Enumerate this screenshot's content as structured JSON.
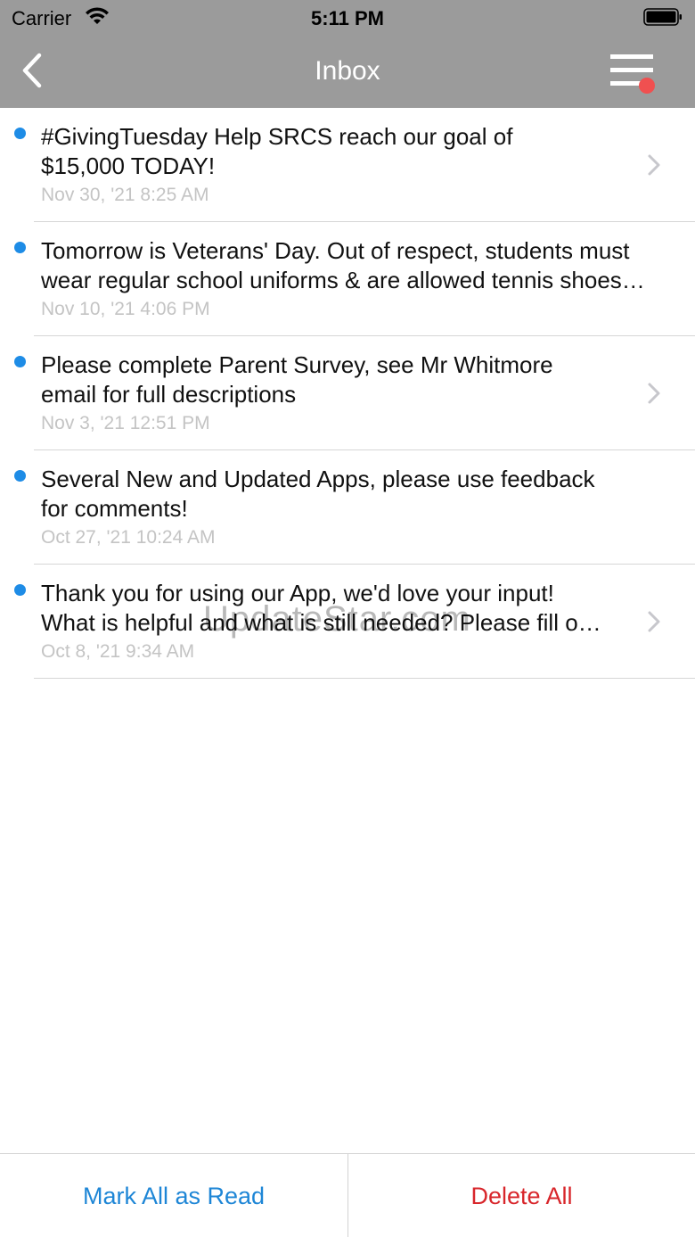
{
  "status_bar": {
    "carrier": "Carrier",
    "time": "5:11 PM"
  },
  "nav": {
    "title": "Inbox",
    "back_icon": "chevron-left-icon",
    "menu_icon": "hamburger-menu-icon",
    "menu_badge_color": "#f05050"
  },
  "messages": [
    {
      "text": "#GivingTuesday Help SRCS reach our goal of\n$15,000 TODAY!",
      "date": "Nov 30, '21 8:25 AM",
      "unread": true,
      "has_chevron": true
    },
    {
      "text": "Tomorrow is Veterans' Day. Out of respect, students must\nwear regular school uniforms & are allowed tennis shoes…",
      "date": "Nov 10, '21 4:06 PM",
      "unread": true,
      "has_chevron": false
    },
    {
      "text": "Please complete Parent Survey, see Mr Whitmore\nemail for full descriptions",
      "date": "Nov 3, '21 12:51 PM",
      "unread": true,
      "has_chevron": true
    },
    {
      "text": "Several New and Updated Apps, please use feedback\nfor comments!",
      "date": "Oct 27, '21 10:24 AM",
      "unread": true,
      "has_chevron": false
    },
    {
      "text": "Thank you for using our App, we'd love your input!\nWhat is helpful and what is still needed? Please fill o…",
      "date": "Oct 8, '21 9:34 AM",
      "unread": true,
      "has_chevron": true
    }
  ],
  "watermark": "UpdateStar.com",
  "toolbar": {
    "mark_all_read": "Mark All as Read",
    "delete_all": "Delete All"
  },
  "colors": {
    "nav_background": "#9b9b9b",
    "unread_dot": "#1e8ce6",
    "mark_read": "#1e86d6",
    "delete": "#d8262b"
  }
}
